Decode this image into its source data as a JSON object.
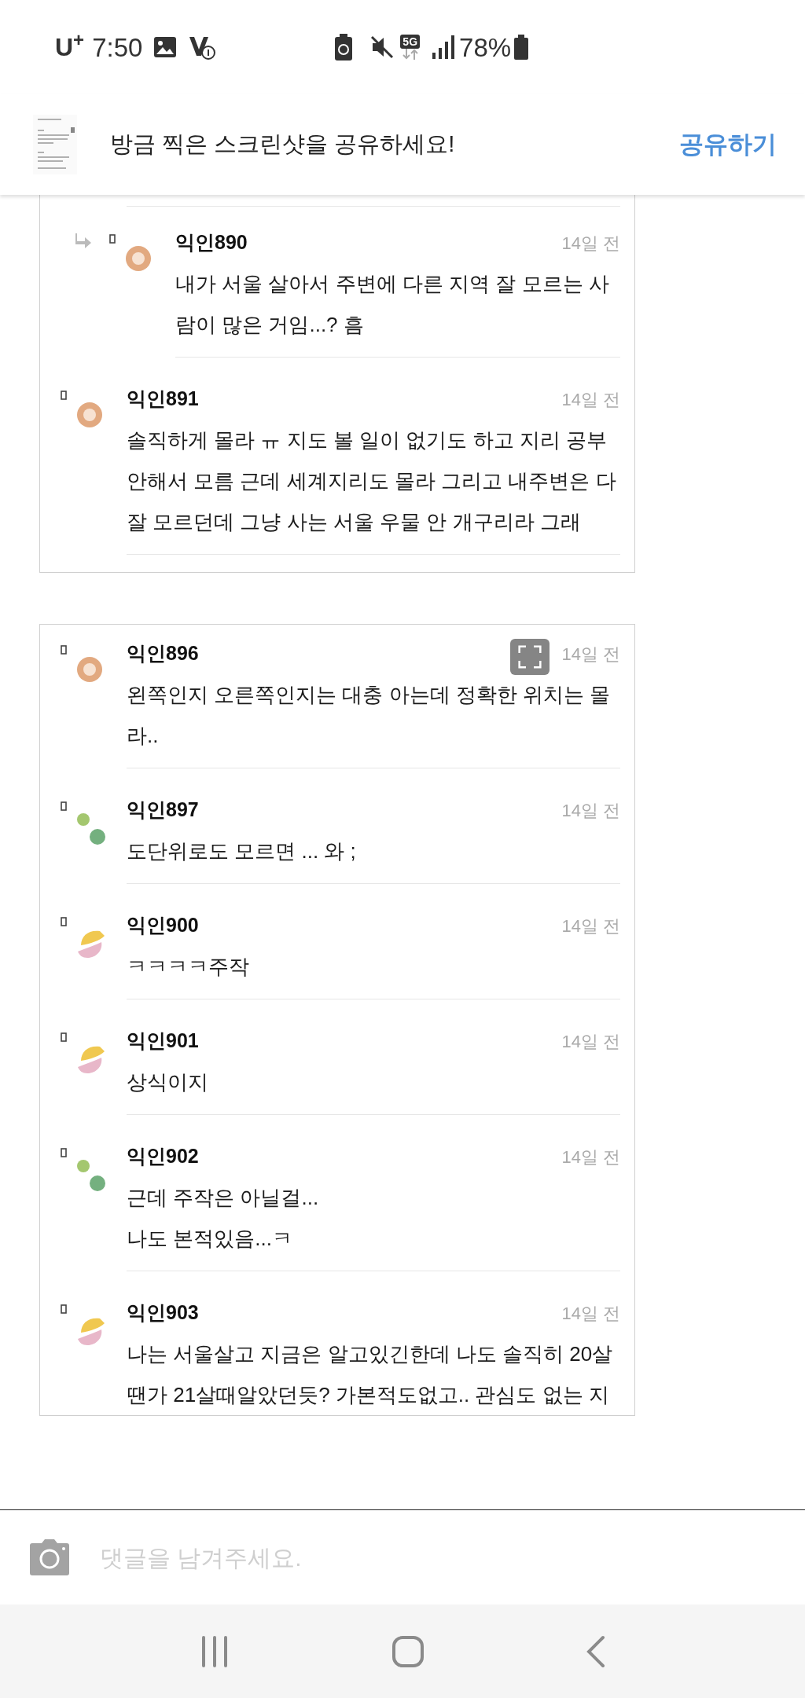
{
  "status_bar": {
    "carrier": "U$^{+}$",
    "time": "7:50",
    "network": "5G",
    "battery": "78%"
  },
  "share_banner": {
    "message": "방금 찍은 스크린샷을 공유하세요!",
    "action": "공유하기"
  },
  "cards": [
    {
      "comments": [
        {
          "kind": "reply",
          "avatar": {
            "kind": "ring"
          },
          "author": "익인890",
          "time": "14일 전",
          "lines": [
            "내가 서울 살아서 주변에 다른 지역 잘 모르는 사",
            "람이 많은 거임...? 흠"
          ]
        },
        {
          "kind": "comment",
          "avatar": {
            "kind": "ring"
          },
          "author": "익인891",
          "time": "14일 전",
          "lines": [
            "솔직하게 몰라 ㅠ 지도 볼 일이 없기도 하고 지리 공부",
            "안해서 모름 근데 세계지리도 몰라 그리고 내주변은 다",
            "잘 모르던데 그냥 사는 서울 우물 안 개구리라 그래"
          ]
        }
      ]
    },
    {
      "comments": [
        {
          "kind": "comment",
          "avatar": {
            "kind": "ring"
          },
          "author": "익인896",
          "time": "14일 전",
          "lines": [
            "왼쪽인지 오른쪽인지는 대충 아는데 정확한 위치는 몰",
            "라.."
          ]
        },
        {
          "kind": "comment",
          "avatar": {
            "kind": "dots"
          },
          "author": "익인897",
          "time": "14일 전",
          "lines": [
            "도단위로도 모르면 ... 와 ;"
          ]
        },
        {
          "kind": "comment",
          "avatar": {
            "kind": "split"
          },
          "author": "익인900",
          "time": "14일 전",
          "lines": [
            "ㅋㅋㅋㅋ주작"
          ]
        },
        {
          "kind": "comment",
          "avatar": {
            "kind": "split"
          },
          "author": "익인901",
          "time": "14일 전",
          "lines": [
            "상식이지"
          ]
        },
        {
          "kind": "comment",
          "avatar": {
            "kind": "dots"
          },
          "author": "익인902",
          "time": "14일 전",
          "lines": [
            "근데 주작은 아닐걸...",
            "나도 본적있음...ㅋ"
          ]
        },
        {
          "kind": "comment",
          "avatar": {
            "kind": "split"
          },
          "author": "익인903",
          "time": "14일 전",
          "lines": [
            "나는 서울살고 지금은 알고있긴한데 나도 솔직히 20살",
            "땐가 21살때알았던듯? 가본적도없고.. 관심도 없는 지"
          ]
        }
      ]
    }
  ],
  "comment_input": {
    "placeholder": "댓글을 남겨주세요."
  }
}
